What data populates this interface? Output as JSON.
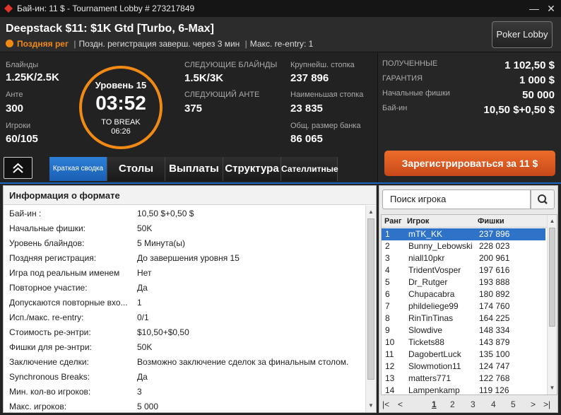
{
  "window": {
    "title": "Бай-ин: 11 $ - Tournament Lobby # 273217849",
    "minimize": "—",
    "close": "✕"
  },
  "header": {
    "tournament_name": "Deepstack $11: $1K Gtd [Turbo, 6-Max]",
    "late_reg": "Поздняя рег",
    "late_reg_info": "Поздн. регистрация заверш. через 3 мин",
    "reentry_info": "Макс. re-entry: 1",
    "lobby_button": "Poker Lobby"
  },
  "stats": {
    "blinds_label": "Блайнды",
    "blinds_value": "1.25K/2.5K",
    "ante_label": "Анте",
    "ante_value": "300",
    "players_label": "Игроки",
    "players_value": "60/105",
    "next_blinds_label": "СЛЕДУЮЩИЕ БЛАЙНДЫ",
    "next_blinds_value": "1.5K/3K",
    "next_ante_label": "СЛЕДУЮЩИЙ АНТЕ",
    "next_ante_value": "375",
    "largest_label": "Крупнейш. стопка",
    "largest_value": "237 896",
    "smallest_label": "Наименьшая стопка",
    "smallest_value": "23 835",
    "total_label": "Общ. размер банка",
    "total_value": "86 065"
  },
  "clock": {
    "level": "Уровень 15",
    "time": "03:52",
    "to_break_label": "TO BREAK",
    "to_break_time": "06:26"
  },
  "prize": {
    "received_label": "ПОЛУЧЕННЫЕ",
    "received_value": "1 102,50 $",
    "guarantee_label": "ГАРАНТИЯ",
    "guarantee_value": "1 000 $",
    "chips_label": "Начальные фишки",
    "chips_value": "50 000",
    "buyin_label": "Бай-ин",
    "buyin_value": "10,50 $+0,50 $"
  },
  "register_button": "Зарегистрироваться за  11 $",
  "tabs": [
    "Краткая сводка",
    "Столы",
    "Выплаты",
    "Структура",
    "Сателлитные"
  ],
  "format_panel": {
    "title": "Информация о формате",
    "rows": [
      {
        "k": "Бай-ин :",
        "v": "10,50 $+0,50 $"
      },
      {
        "k": "Начальные фишки:",
        "v": "50K"
      },
      {
        "k": "Уровень блайндов:",
        "v": "5 Минута(ы)"
      },
      {
        "k": "Поздняя регистрация:",
        "v": "До завершения уровня 15"
      },
      {
        "k": "Игра под реальным именем",
        "v": "Нет"
      },
      {
        "k": "Повторное участие:",
        "v": "Да"
      },
      {
        "k": "Допускаются повторные вхо...",
        "v": "1"
      },
      {
        "k": "Исп./макс. re-entry:",
        "v": "0/1"
      },
      {
        "k": "Стоимость ре-энтри:",
        "v": "$10,50+$0,50"
      },
      {
        "k": "Фишки для ре-энтри:",
        "v": "50K"
      },
      {
        "k": "Заключение сделки:",
        "v": "Возможно заключение сделок за финальным столом."
      },
      {
        "k": "Synchronous Breaks:",
        "v": "Да"
      },
      {
        "k": "Мин. кол-во игроков:",
        "v": "3"
      },
      {
        "k": "Макс. игроков:",
        "v": "5 000"
      }
    ]
  },
  "players_panel": {
    "search_placeholder": "Поиск игрока",
    "col_rank": "Ранг",
    "col_player": "Игрок",
    "col_chips": "Фишки",
    "rows": [
      {
        "r": "1",
        "n": "mTK_KK",
        "c": "237 896"
      },
      {
        "r": "2",
        "n": "Bunny_Lebowski",
        "c": "228 023"
      },
      {
        "r": "3",
        "n": "niall10pkr",
        "c": "200 961"
      },
      {
        "r": "4",
        "n": "TridentVosper",
        "c": "197 616"
      },
      {
        "r": "5",
        "n": "Dr_Rutger",
        "c": "193 888"
      },
      {
        "r": "6",
        "n": "Chupacabra",
        "c": "180 892"
      },
      {
        "r": "7",
        "n": "phildeliege99",
        "c": "174 760"
      },
      {
        "r": "8",
        "n": "RinTinTinas",
        "c": "164 225"
      },
      {
        "r": "9",
        "n": "Slowdive",
        "c": "148 334"
      },
      {
        "r": "10",
        "n": "Tickets88",
        "c": "143 879"
      },
      {
        "r": "11",
        "n": "DagobertLuck",
        "c": "135 100"
      },
      {
        "r": "12",
        "n": "Slowmotion11",
        "c": "124 747"
      },
      {
        "r": "13",
        "n": "matters771",
        "c": "122 768"
      },
      {
        "r": "14",
        "n": "Lampenkamp",
        "c": "119 126"
      }
    ],
    "pages": [
      "1",
      "2",
      "3",
      "4",
      "5"
    ]
  }
}
